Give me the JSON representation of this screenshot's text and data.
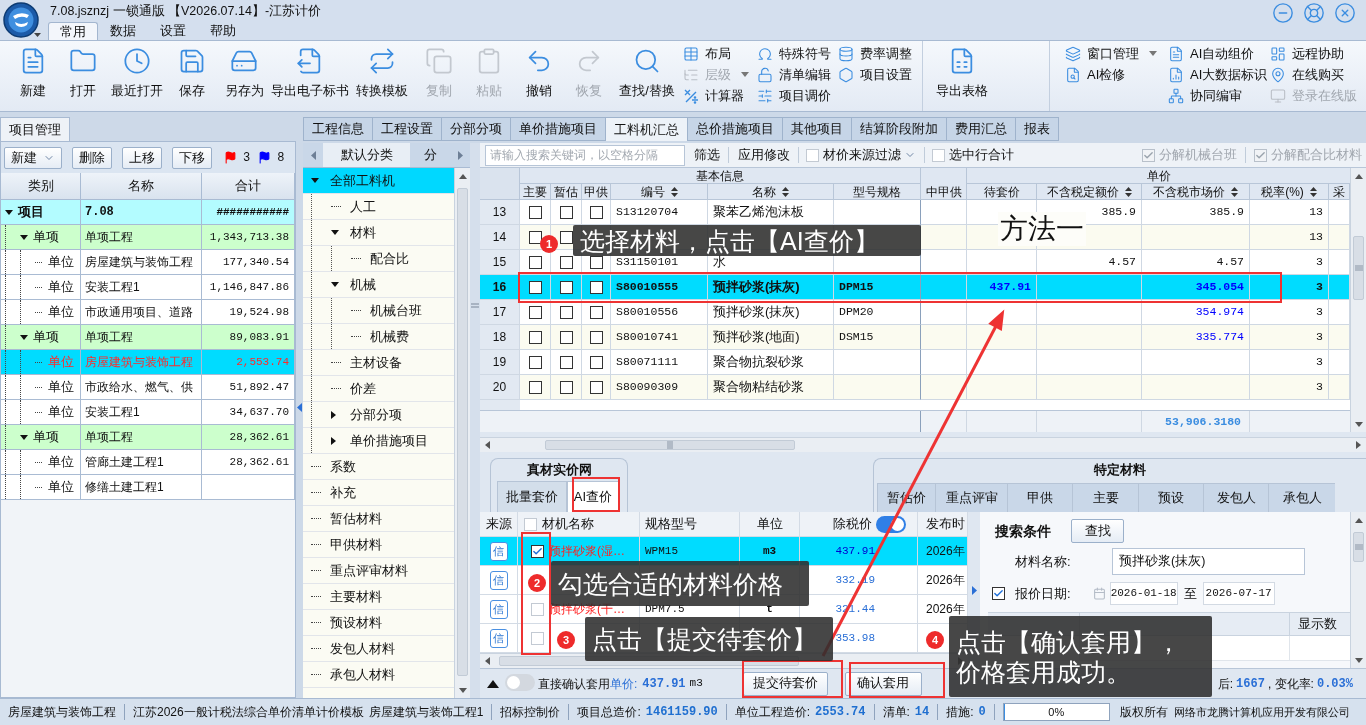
{
  "window": {
    "title": "7.08.jsznzj 一锁通版 【V2026.07.14】-江苏计价"
  },
  "ribbon_tabs": [
    {
      "label": "常用",
      "selected": true
    },
    {
      "label": "数据",
      "selected": false
    },
    {
      "label": "设置",
      "selected": false
    },
    {
      "label": "帮助",
      "selected": false
    }
  ],
  "toolbar": {
    "large_buttons": [
      {
        "label": "新建",
        "disabled": false
      },
      {
        "label": "打开",
        "disabled": false
      },
      {
        "label": "最近打开",
        "disabled": false
      },
      {
        "label": "保存",
        "disabled": false
      },
      {
        "label": "另存为",
        "disabled": false
      },
      {
        "label": "导出电子标书",
        "disabled": false
      },
      {
        "label": "转换模板",
        "disabled": false
      },
      {
        "label": "复制",
        "disabled": true
      },
      {
        "label": "粘贴",
        "disabled": true
      },
      {
        "label": "撤销",
        "disabled": false
      },
      {
        "label": "恢复",
        "disabled": true
      },
      {
        "label": "查找/替换",
        "disabled": false
      }
    ],
    "small_columns": [
      [
        {
          "label": "布局",
          "disabled": false,
          "dropdown": false
        },
        {
          "label": "层级",
          "disabled": true,
          "dropdown": true
        },
        {
          "label": "计算器",
          "disabled": false,
          "dropdown": false
        }
      ],
      [
        {
          "label": "特殊符号",
          "disabled": false,
          "dropdown": false
        },
        {
          "label": "清单编辑",
          "disabled": false,
          "dropdown": false
        },
        {
          "label": "项目调价",
          "disabled": false,
          "dropdown": false
        }
      ],
      [
        {
          "label": "费率调整",
          "disabled": false,
          "dropdown": false
        },
        {
          "label": "项目设置",
          "disabled": false,
          "dropdown": false
        }
      ]
    ],
    "export_button": {
      "label": "导出表格"
    },
    "ai_columns": [
      [
        {
          "label": "窗口管理",
          "disabled": false,
          "dropdown": true
        },
        {
          "label": "AI检修",
          "disabled": false,
          "dropdown": false
        }
      ],
      [
        {
          "label": "AI自动组价",
          "disabled": false,
          "dropdown": false
        },
        {
          "label": "AI大数据标识",
          "disabled": false,
          "dropdown": false
        },
        {
          "label": "协同编审",
          "disabled": false,
          "dropdown": false
        }
      ],
      [
        {
          "label": "远程协助",
          "disabled": false,
          "dropdown": false
        },
        {
          "label": "在线购买",
          "disabled": false,
          "dropdown": false
        },
        {
          "label": "登录在线版",
          "disabled": true,
          "dropdown": false
        }
      ]
    ]
  },
  "project_panel": {
    "tab": {
      "label": "项目管理",
      "selected": true
    },
    "buttons": [
      {
        "label": "新建",
        "dropdown": true
      },
      {
        "label": "删除",
        "dropdown": false
      },
      {
        "label": "上移",
        "dropdown": false
      },
      {
        "label": "下移",
        "dropdown": false
      }
    ],
    "flags": [
      {
        "color": "#ff0000",
        "count": "3"
      },
      {
        "color": "#0000ff",
        "count": "8"
      }
    ],
    "columns": [
      "类别",
      "名称",
      "合计"
    ],
    "tree": [
      {
        "kind": "project",
        "category": "项目",
        "name": "7.08",
        "total": "###########",
        "selected": false,
        "expanded": true,
        "children": [
          {
            "kind": "item",
            "category": "单项",
            "name": "单项工程",
            "total": "1,343,713.38",
            "selected": false,
            "expanded": true,
            "children": [
              {
                "kind": "unit",
                "category": "单位",
                "name": "房屋建筑与装饰工程",
                "total": "177,340.54",
                "selected": false
              },
              {
                "kind": "unit",
                "category": "单位",
                "name": "安装工程1",
                "total": "1,146,847.86",
                "selected": false
              },
              {
                "kind": "unit",
                "category": "单位",
                "name": "市政通用项目、道路",
                "total": "19,524.98",
                "selected": false
              }
            ]
          },
          {
            "kind": "item",
            "category": "单项",
            "name": "单项工程",
            "total": "89,083.91",
            "selected": false,
            "expanded": true,
            "children": [
              {
                "kind": "unit",
                "category": "单位",
                "name": "房屋建筑与装饰工程",
                "total": "2,553.74",
                "selected": true
              },
              {
                "kind": "unit",
                "category": "单位",
                "name": "市政给水、燃气、供",
                "total": "51,892.47",
                "selected": false
              },
              {
                "kind": "unit",
                "category": "单位",
                "name": "安装工程1",
                "total": "34,637.70",
                "selected": false
              }
            ]
          },
          {
            "kind": "item",
            "category": "单项",
            "name": "单项工程",
            "total": "28,362.61",
            "selected": false,
            "expanded": true,
            "children": [
              {
                "kind": "unit",
                "category": "单位",
                "name": "管廊土建工程1",
                "total": "28,362.61",
                "selected": false
              },
              {
                "kind": "unit",
                "category": "单位",
                "name": "修缮土建工程1",
                "selected": false
              }
            ]
          }
        ]
      }
    ]
  },
  "module_tabs": [
    {
      "label": "工程信息",
      "selected": false
    },
    {
      "label": "工程设置",
      "selected": false
    },
    {
      "label": "分部分项",
      "selected": false
    },
    {
      "label": "单价措施项目",
      "selected": false
    },
    {
      "label": "工料机汇总",
      "selected": true
    },
    {
      "label": "总价措施项目",
      "selected": false
    },
    {
      "label": "其他项目",
      "selected": false
    },
    {
      "label": "结算阶段附加",
      "selected": false
    },
    {
      "label": "费用汇总",
      "selected": false
    },
    {
      "label": "报表",
      "selected": false
    }
  ],
  "category_panel": {
    "tabs": [
      {
        "label": "默认分类",
        "selected": true
      },
      {
        "label": "分",
        "selected": false
      }
    ],
    "tree": [
      {
        "label": "全部工料机",
        "selected": true,
        "expanded": true,
        "children": [
          {
            "label": "人工",
            "selected": false
          },
          {
            "label": "材料",
            "selected": false,
            "expanded": true,
            "children": [
              {
                "label": "配合比",
                "selected": false
              }
            ]
          },
          {
            "label": "机械",
            "selected": false,
            "expanded": true,
            "children": [
              {
                "label": "机械台班",
                "selected": false
              },
              {
                "label": "机械费",
                "selected": false
              }
            ]
          },
          {
            "label": "主材设备",
            "selected": false
          },
          {
            "label": "价差",
            "selected": false
          },
          {
            "label": "分部分项",
            "selected": false,
            "expanded": false
          },
          {
            "label": "单价措施项目",
            "selected": false,
            "expanded": false
          }
        ]
      },
      {
        "label": "系数",
        "selected": false
      },
      {
        "label": "补充",
        "selected": false
      },
      {
        "label": "暂估材料",
        "selected": false
      },
      {
        "label": "甲供材料",
        "selected": false
      },
      {
        "label": "重点评审材料",
        "selected": false
      },
      {
        "label": "主要材料",
        "selected": false
      },
      {
        "label": "预设材料",
        "selected": false
      },
      {
        "label": "发包人材料",
        "selected": false
      },
      {
        "label": "承包人材料",
        "selected": false
      }
    ]
  },
  "grid_toolbar": {
    "search": {
      "placeholder": "请输入搜索关键词，以空格分隔"
    },
    "buttons": [
      "筛选",
      "应用修改"
    ],
    "filters": [
      {
        "label": "材价来源过滤",
        "checked": false,
        "dropdown": true
      },
      {
        "label": "选中行合计",
        "checked": false,
        "dropdown": false
      }
    ],
    "options": [
      {
        "label": "分解机械台班",
        "checked": true,
        "disabled": true
      },
      {
        "label": "分解配合比材料",
        "checked": true,
        "disabled": true
      }
    ]
  },
  "material_grid": {
    "groups": [
      "基本信息",
      "单价"
    ],
    "columns": [
      {
        "label": "主要",
        "sortable": false
      },
      {
        "label": "暂估",
        "sortable": false
      },
      {
        "label": "甲供",
        "sortable": false
      },
      {
        "label": "编号",
        "sortable": true
      },
      {
        "label": "名称",
        "sortable": true
      },
      {
        "label": "型号规格",
        "sortable": false
      },
      {
        "label": "中甲供",
        "sortable": false
      },
      {
        "label": "待套价",
        "sortable": false
      },
      {
        "label": "不含税定额价",
        "sortable": true
      },
      {
        "label": "不含税市场价",
        "sortable": true
      },
      {
        "label": "税率(%)",
        "sortable": true
      },
      {
        "label": "采",
        "sortable": false
      }
    ],
    "rows": [
      {
        "index": "13",
        "selected": false,
        "checks": [
          {
            "checked": false
          },
          {
            "checked": false
          },
          {
            "checked": false
          }
        ],
        "code": "S13120704",
        "name": "聚苯乙烯泡沫板",
        "quota_price": "385.9",
        "market_price": "385.9",
        "modified": false,
        "tax_rate": "13"
      },
      {
        "index": "14",
        "selected": false,
        "checks": [
          {
            "checked": false
          },
          {
            "checked": false
          }
        ],
        "tax_rate": "13"
      },
      {
        "index": "15",
        "selected": false,
        "checks": [
          {
            "checked": false
          },
          {
            "checked": false
          },
          {
            "checked": false
          }
        ],
        "code": "S31150101",
        "name": "水",
        "quota_price": "4.57",
        "market_price": "4.57",
        "modified": false,
        "tax_rate": "3"
      },
      {
        "index": "16",
        "selected": true,
        "checks": [
          {
            "checked": false
          },
          {
            "checked": false
          },
          {
            "checked": false
          }
        ],
        "code": "S80010555",
        "name": "预拌砂浆(抹灰)",
        "spec": "DPM15",
        "pending_price": "437.91",
        "market_price": "345.054",
        "modified": true,
        "tax_rate": "3"
      },
      {
        "index": "17",
        "selected": false,
        "checks": [
          {
            "checked": false
          },
          {
            "checked": false
          },
          {
            "checked": false
          }
        ],
        "code": "S80010556",
        "name": "预拌砂浆(抹灰)",
        "spec": "DPM20",
        "market_price": "354.974",
        "modified": true,
        "tax_rate": "3"
      },
      {
        "index": "18",
        "selected": false,
        "checks": [
          {
            "checked": false
          },
          {
            "checked": false
          },
          {
            "checked": false
          }
        ],
        "code": "S80010741",
        "name": "预拌砂浆(地面)",
        "spec": "DSM15",
        "market_price": "335.774",
        "modified": true,
        "tax_rate": "3"
      },
      {
        "index": "19",
        "selected": false,
        "checks": [
          {
            "checked": false
          },
          {
            "checked": false
          },
          {
            "checked": false
          }
        ],
        "code": "S80071111",
        "name": "聚合物抗裂砂浆",
        "tax_rate": "3"
      },
      {
        "index": "20",
        "selected": false,
        "checks": [
          {
            "checked": false
          },
          {
            "checked": false
          },
          {
            "checked": false
          }
        ],
        "code": "S80090309",
        "name": "聚合物粘结砂浆",
        "tax_rate": "3"
      }
    ],
    "totals": {
      "market_price": "53,906.3180"
    }
  },
  "price_lookup": {
    "source_group": {
      "title": "真材实价网",
      "tabs": [
        {
          "label": "批量套价",
          "selected": false
        },
        {
          "label": "AI查价",
          "selected": true
        }
      ]
    },
    "special_group": {
      "title": "特定材料",
      "tabs": [
        {
          "label": "暂估价",
          "selected": false
        },
        {
          "label": "重点评审",
          "selected": false
        },
        {
          "label": "甲供",
          "selected": false
        },
        {
          "label": "主要",
          "selected": false
        },
        {
          "label": "预设",
          "selected": false
        },
        {
          "label": "发包人",
          "selected": false
        },
        {
          "label": "承包人",
          "selected": false
        }
      ]
    },
    "results": {
      "columns": [
        "来源",
        "材机名称",
        "规格型号",
        "单位",
        "除税价",
        "发布时"
      ],
      "select_all": {
        "checked": false
      },
      "tax_toggle": {
        "on": true
      },
      "rows": [
        {
          "source": "信",
          "checked": true,
          "name": "预拌砂浆(湿…",
          "spec": "WPM15",
          "unit": "m3",
          "price": "437.91",
          "date": "2026年",
          "selected": true
        },
        {
          "source": "信",
          "price": "332.19",
          "date": "2026年",
          "selected": false
        },
        {
          "source": "信",
          "checked": false,
          "name": "预拌砂浆(干…",
          "spec": "DPM7.5",
          "unit": "t",
          "price": "321.44",
          "date": "2026年",
          "selected": false
        },
        {
          "source": "信",
          "checked": false,
          "price": "353.98",
          "selected": false
        }
      ]
    },
    "search": {
      "title": "搜索条件",
      "find_button": "查找",
      "material_name": {
        "label": "材料名称:",
        "value": "预拌砂浆(抹灰)"
      },
      "quote_date": {
        "label": "报价日期:",
        "checked": true,
        "from": "2026-01-18",
        "separator": "至",
        "to": "2026-07-17"
      },
      "conditions": {
        "column_3": "显示数"
      }
    },
    "footer": {
      "direct_apply": {
        "label": "直接确认套用",
        "on": false
      },
      "unit_price": {
        "label": "单价:",
        "value": "437.91",
        "unit": "m3"
      },
      "buttons": [
        "提交待套价",
        "确认套用"
      ],
      "summary": [
        {
          "kind": "label",
          "text": "后:"
        },
        {
          "kind": "value",
          "text": "1667"
        },
        {
          "kind": "label",
          "text": ", 变化率:"
        },
        {
          "kind": "value",
          "text": "0.03%"
        }
      ]
    }
  },
  "status_bar": {
    "sections": [
      [
        {
          "label": "房屋建筑与装饰工程"
        }
      ],
      [
        {
          "label": "江苏2026一般计税法综合单价清单计价模板"
        },
        {
          "label": "房屋建筑与装饰工程1"
        }
      ],
      [
        {
          "label": "招标控制价"
        }
      ],
      [
        {
          "label": "项目总造价:",
          "value": "1461159.90"
        }
      ],
      [
        {
          "label": "单位工程造价:",
          "value": "2553.74"
        }
      ],
      [
        {
          "label": "清单:",
          "value": "14"
        }
      ],
      [
        {
          "label": "措施:",
          "value": "0"
        }
      ]
    ],
    "progress": {
      "level": 0,
      "text": "0%"
    },
    "copyright": {
      "label": "版权所有",
      "company": "网络市龙腾计算机应用开发有限公司"
    }
  },
  "annotations": {
    "method": "方法一",
    "callouts": [
      {
        "number": "1",
        "text": "选择材料，点击【AI查价】"
      },
      {
        "number": "2",
        "text": "勾选合适的材料价格"
      },
      {
        "number": "3",
        "text": "点击【提交待套价】"
      },
      {
        "number": "4",
        "text": "点击【确认套用】，价格套用成功。"
      }
    ]
  }
}
